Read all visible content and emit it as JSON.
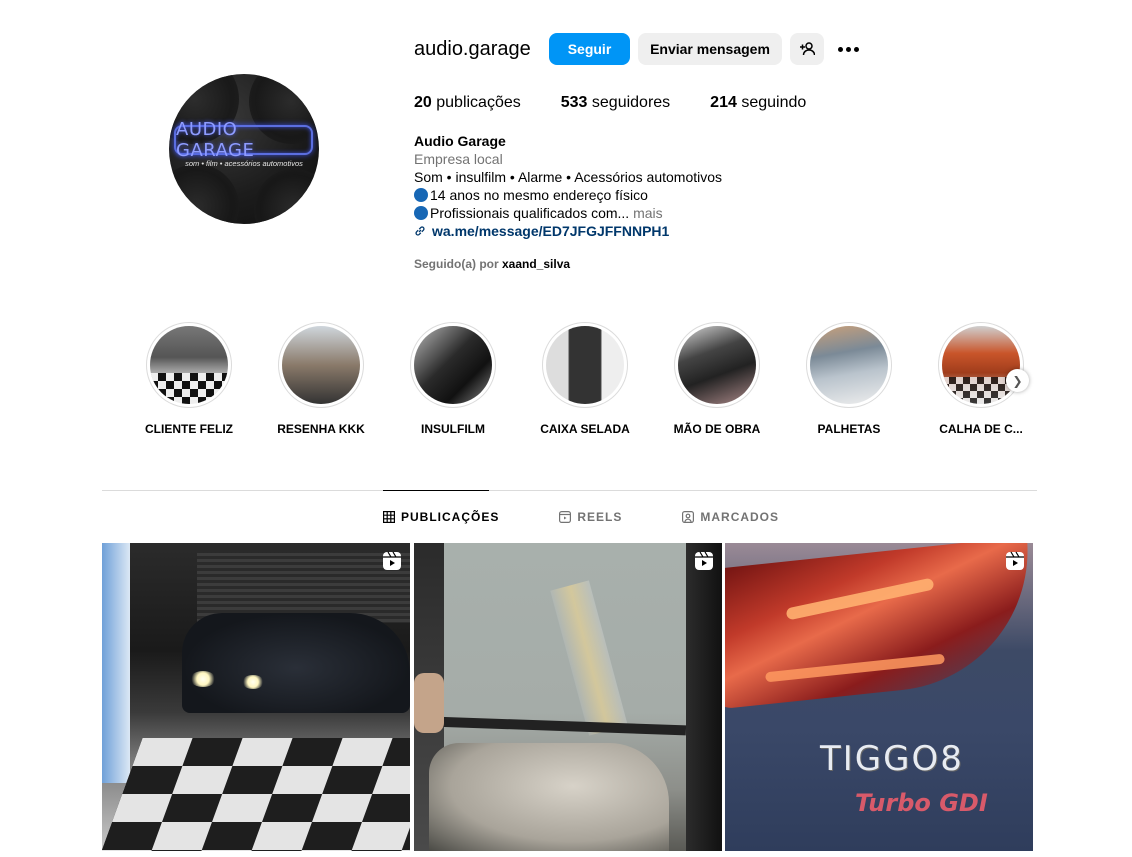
{
  "profile": {
    "username": "audio.garage",
    "avatar_text": "AUDIO GARAGE",
    "avatar_tagline": "som • film • acessórios automotivos",
    "follow_label": "Seguir",
    "message_label": "Enviar mensagem",
    "add_user_icon": "add-user-icon",
    "more_icon": "more-options-icon",
    "stats": [
      {
        "count": "20",
        "label": " publicações"
      },
      {
        "count": "533",
        "label": " seguidores"
      },
      {
        "count": "214",
        "label": " seguindo"
      }
    ],
    "bio": {
      "name": "Audio Garage",
      "category": "Empresa local",
      "line1": "Som • insulfilm • Alarme • Acessórios automotivos",
      "line2": "14 anos no mesmo endereço físico",
      "line3": "Profissionais qualificados com...",
      "more": " mais",
      "link": "wa.me/message/ED7JFGJFFNNPH1"
    },
    "followed_by_prefix": "Seguido(a) por ",
    "followed_by_user": "xaand_silva"
  },
  "highlights": [
    {
      "label": "CLIENTE FELIZ"
    },
    {
      "label": "RESENHA KKK"
    },
    {
      "label": "INSULFILM"
    },
    {
      "label": "CAIXA SELADA"
    },
    {
      "label": "MÃO DE OBRA"
    },
    {
      "label": "PALHETAS"
    },
    {
      "label": "CALHA DE C..."
    }
  ],
  "tabs": [
    {
      "label": "PUBLICAÇÕES",
      "icon": "grid-icon",
      "active": true
    },
    {
      "label": "REELS",
      "icon": "reels-icon",
      "active": false
    },
    {
      "label": "MARCADOS",
      "icon": "tagged-icon",
      "active": false
    }
  ],
  "posts": [
    {
      "type": "reel",
      "subject": "car-night-checkered-floor"
    },
    {
      "type": "reel",
      "subject": "window-film-install"
    },
    {
      "type": "reel",
      "subject": "tiggo8-taillight",
      "badge_text": "TIGGO8",
      "badge_sub": "Turbo GDI"
    }
  ],
  "colors": {
    "accent": "#0095f6",
    "secondary_bg": "#efefef",
    "muted": "#737373",
    "link": "#00376b"
  }
}
